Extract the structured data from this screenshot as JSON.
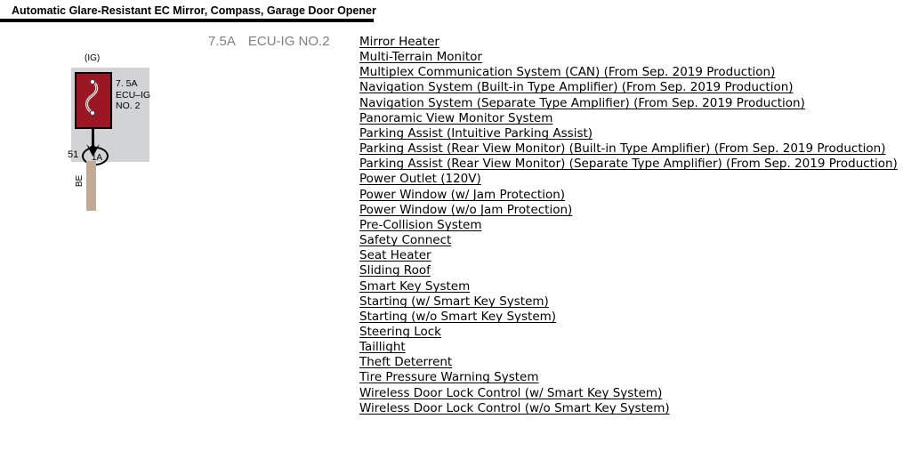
{
  "title": "Automatic Glare-Resistant EC Mirror, Compass, Garage Door Opener",
  "fuse_heading": {
    "amperage": "7.5A",
    "name": "ECU-IG NO.2"
  },
  "diagram": {
    "ig_label": "(IG)",
    "fuse_rating_line1": "7. 5A",
    "fuse_rating_line2": "ECU–IG",
    "fuse_rating_line3": "NO. 2",
    "connector_number": "51",
    "connector_label": "1A",
    "wire_color_code": "BE",
    "colors": {
      "fuse_fill": "#9c1623",
      "panel_background": "#d1d3d4",
      "wire": "#c2ab92",
      "outline": "#000000",
      "heading_text": "#808080"
    }
  },
  "systems": [
    "Mirror Heater",
    "Multi-Terrain Monitor",
    "Multiplex Communication System (CAN) (From Sep. 2019 Production)",
    "Navigation System (Built-in Type Amplifier) (From Sep. 2019 Production)",
    "Navigation System (Separate Type Amplifier) (From Sep. 2019 Production)",
    "Panoramic View Monitor System",
    "Parking Assist (Intuitive Parking Assist)",
    "Parking Assist (Rear View Monitor) (Built-in Type Amplifier) (From Sep. 2019 Production)",
    "Parking Assist (Rear View Monitor) (Separate Type Amplifier) (From Sep. 2019 Production)",
    "Power Outlet (120V)",
    "Power Window (w/ Jam Protection)",
    "Power Window (w/o Jam Protection)",
    "Pre-Collision System",
    "Safety Connect",
    "Seat Heater",
    "Sliding Roof",
    "Smart Key System",
    "Starting (w/ Smart Key System)",
    "Starting (w/o Smart Key System)",
    "Steering Lock",
    "Taillight",
    "Theft Deterrent",
    "Tire Pressure Warning System",
    "Wireless Door Lock Control (w/ Smart Key System)",
    "Wireless Door Lock Control (w/o Smart Key System)"
  ]
}
